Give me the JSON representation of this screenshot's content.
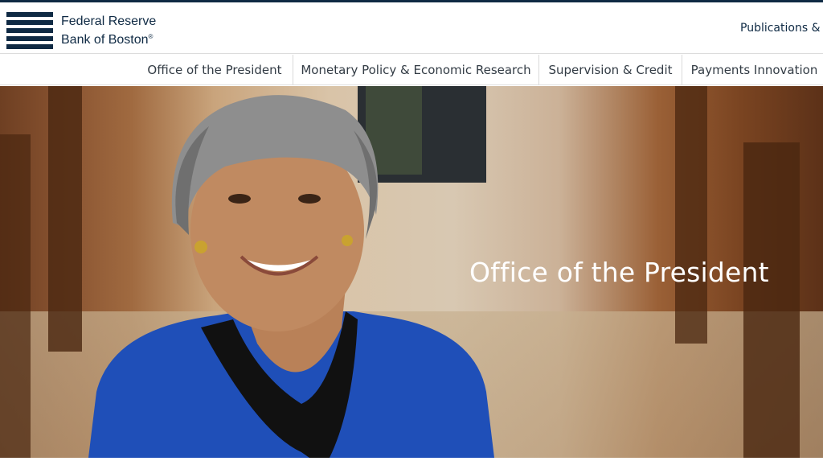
{
  "header": {
    "logo": {
      "line1": "Federal Reserve",
      "line2": "Bank of Boston",
      "mark": "®"
    },
    "utility_link": "Publications &"
  },
  "nav": {
    "items": [
      {
        "label": "Office of the President"
      },
      {
        "label": "Monetary Policy & Economic Research"
      },
      {
        "label": "Supervision & Credit"
      },
      {
        "label": "Payments Innovation"
      }
    ]
  },
  "hero": {
    "title": "Office of the President",
    "image_icon": "portrait-photo"
  },
  "colors": {
    "brand_navy": "#0f2a44",
    "nav_text": "#333c45",
    "hero_text": "#ffffff"
  }
}
